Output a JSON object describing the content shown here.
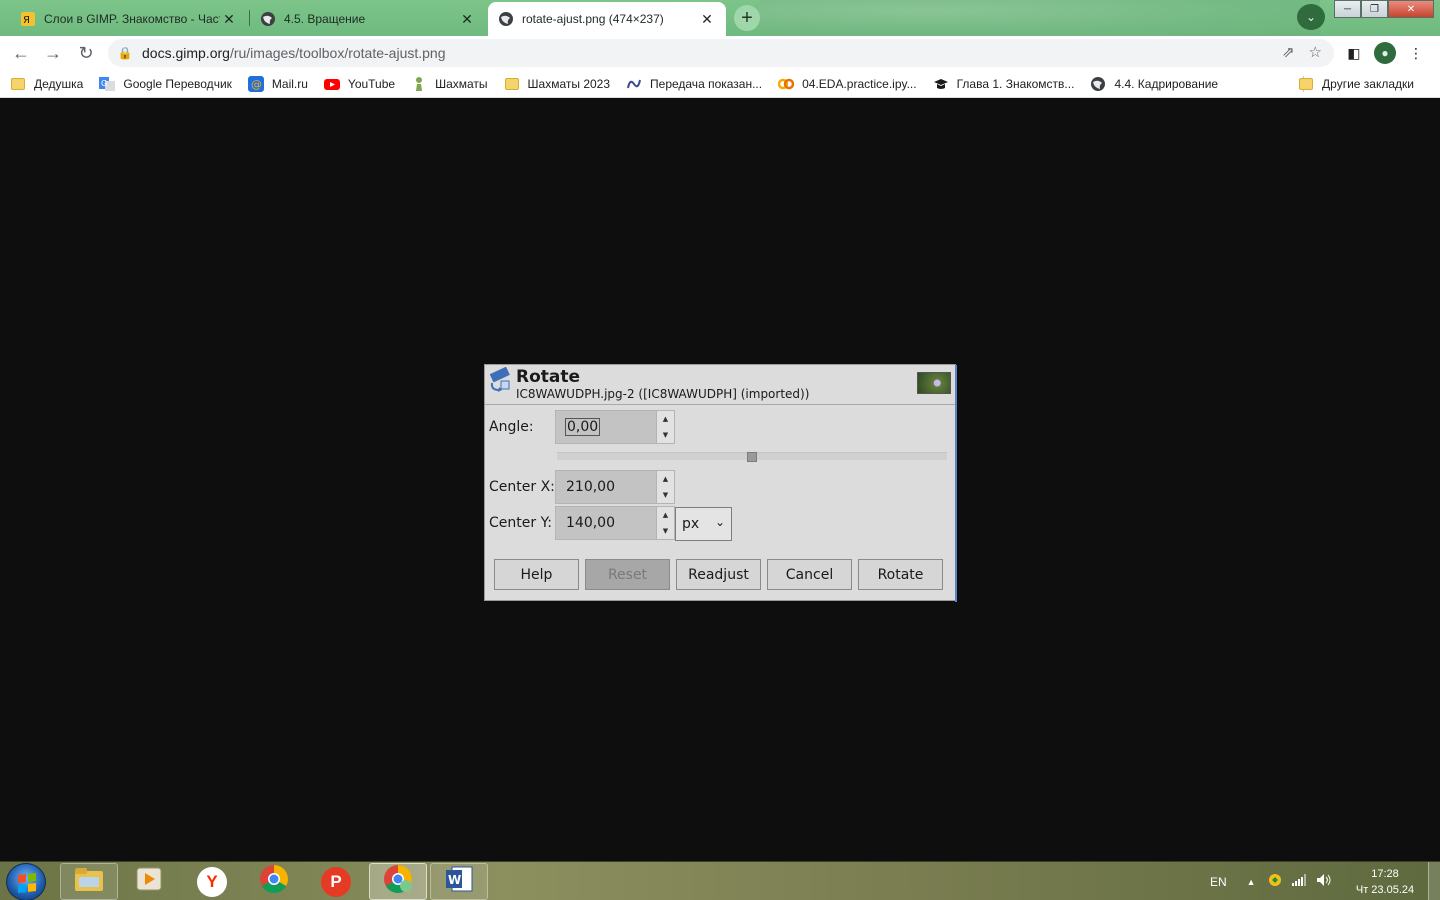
{
  "browser": {
    "tabs": [
      {
        "title": "Слои в GIMP. Знакомство - Част",
        "close": "✕",
        "active": false
      },
      {
        "title": "4.5. Вращение",
        "close": "✕",
        "active": false
      },
      {
        "title": "rotate-ajust.png (474×237)",
        "close": "✕",
        "active": true
      }
    ],
    "new_tab": "+",
    "url_host": "docs.gimp.org",
    "url_path": "/ru/images/toolbox/rotate-ajust.png",
    "bookmarks": [
      {
        "label": "Дедушка",
        "icon": "folder-icon"
      },
      {
        "label": "Google Переводчик",
        "icon": "google-translate-icon"
      },
      {
        "label": "Mail.ru",
        "icon": "mailru-icon"
      },
      {
        "label": "YouTube",
        "icon": "youtube-icon"
      },
      {
        "label": "Шахматы",
        "icon": "chess-pawn-icon"
      },
      {
        "label": "Шахматы 2023",
        "icon": "folder-icon"
      },
      {
        "label": "Передача показан...",
        "icon": "meter-icon"
      },
      {
        "label": "04.EDA.practice.ipy...",
        "icon": "colab-icon"
      },
      {
        "label": "Глава 1. Знакомств...",
        "icon": "graduation-cap-icon"
      },
      {
        "label": "4.4. Кадрирование",
        "icon": "globe-icon"
      }
    ],
    "other_bookmarks": "Другие закладки"
  },
  "dialog": {
    "title": "Rotate",
    "subtitle": "IC8WAWUDPH.jpg-2 ([IC8WAWUDPH] (imported))",
    "angle_label": "Angle:",
    "angle_value": "0,00",
    "angle_slider_fraction": 0.5,
    "center_x_label": "Center X:",
    "center_x_value": "210,00",
    "center_y_label": "Center Y:",
    "center_y_value": "140,00",
    "unit": "px",
    "buttons": {
      "help": "Help",
      "reset": "Reset",
      "readjust": "Readjust",
      "cancel": "Cancel",
      "rotate": "Rotate"
    }
  },
  "taskbar": {
    "language": "EN",
    "time": "17:28",
    "date": "Чт 23.05.24"
  }
}
